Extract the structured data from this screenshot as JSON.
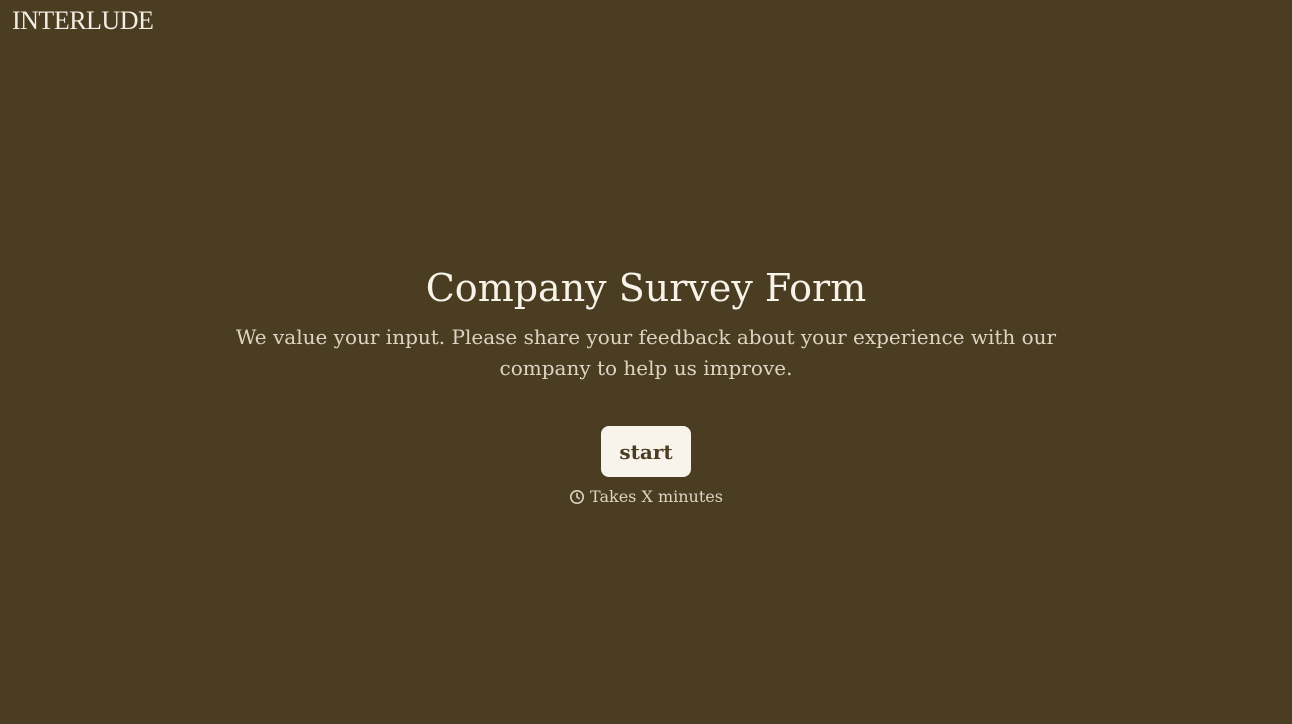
{
  "brand": {
    "logo_text": "INTERLUDE"
  },
  "survey": {
    "title": "Company Survey Form",
    "description": "We value your input. Please share your feedback about your experience with our company to help us improve.",
    "start_label": "start",
    "duration_text": "Takes X minutes",
    "duration_icon": "clock-icon"
  },
  "colors": {
    "background": "#4a3d22",
    "button_bg": "#f8f4ec",
    "button_text": "#4a3d22",
    "text_primary": "#f8f3e9",
    "text_secondary": "#ddd5c4"
  }
}
